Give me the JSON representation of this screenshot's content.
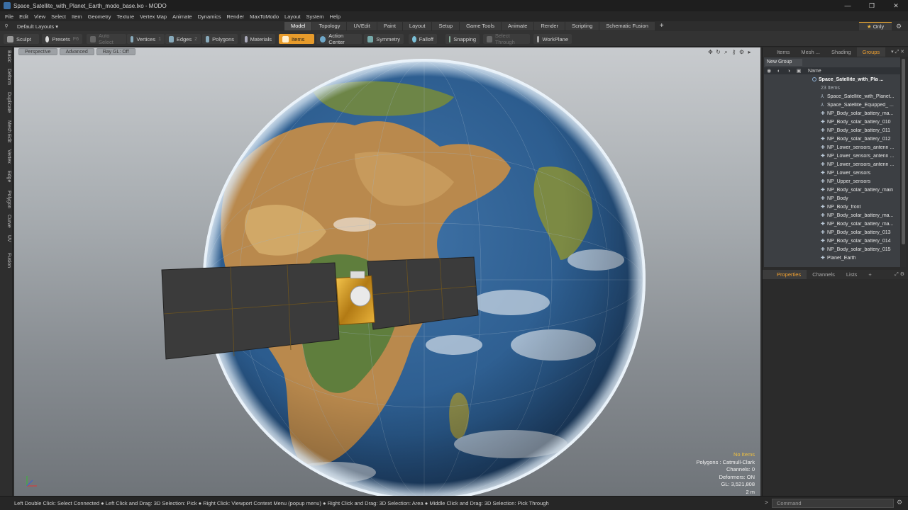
{
  "window": {
    "title": "Space_Satellite_with_Planet_Earth_modo_base.lxo - MODO",
    "controls": [
      "—",
      "❐",
      "✕"
    ]
  },
  "menu": [
    "File",
    "Edit",
    "View",
    "Select",
    "Item",
    "Geometry",
    "Texture",
    "Vertex Map",
    "Animate",
    "Dynamics",
    "Render",
    "MaxToModo",
    "Layout",
    "System",
    "Help"
  ],
  "layout": {
    "preset": "Default Layouts ▾",
    "tabs": [
      "Model",
      "Topology",
      "UVEdit",
      "Paint",
      "Layout",
      "Setup",
      "Game Tools",
      "Animate",
      "Render",
      "Scripting",
      "Schematic Fusion"
    ],
    "active_tab": "Model",
    "plus": "+",
    "only_label": "Only"
  },
  "toolbar": {
    "sculpt": "Sculpt",
    "presets": "Presets",
    "presets_key": "F6",
    "auto_select": "Auto Select",
    "vertices": "Vertices",
    "vertices_key": "1",
    "edges": "Edges",
    "edges_key": "2",
    "polygons": "Polygons",
    "materials": "Materials",
    "items": "Items",
    "action_center": "Action Center",
    "symmetry": "Symmetry",
    "falloff": "Falloff",
    "snapping": "Snapping",
    "select_through": "Select Through",
    "workplane": "WorkPlane"
  },
  "left_tabs": [
    "Basic",
    "Deform",
    "Duplicate",
    "Mesh Edit",
    "Vertex",
    "Edge",
    "Polygon",
    "Curve",
    "UV",
    "Fusion"
  ],
  "viewport": {
    "view_mode": "Perspective",
    "shading": "Advanced",
    "raygl": "Ray GL: Off",
    "info": {
      "no_items": "No Items",
      "polygons": "Polygons : Catmull-Clark",
      "channels": "Channels: 0",
      "deformers": "Deformers: ON",
      "gl": "GL: 3,521,808",
      "scale": "2 m"
    }
  },
  "panel_tabs": [
    "Items",
    "Mesh ...",
    "Shading",
    "Groups"
  ],
  "panel_active": "Groups",
  "groups": {
    "new_group": "New Group",
    "name_header": "Name",
    "root": "Space_Satellite_with_Pla ...",
    "count": "23 Items",
    "items": [
      "Space_Satellite_with_Planet...",
      "Space_Satellite_Equipped_ ...",
      "NP_Body_solar_battery_ma...",
      "NP_Body_solar_battery_010",
      "NP_Body_solar_battery_011",
      "NP_Body_solar_battery_012",
      "NP_Lower_sensors_antenn ...",
      "NP_Lower_sensors_antenn ...",
      "NP_Lower_sensors_antenn ...",
      "NP_Lower_sensors",
      "NP_Upper_sensors",
      "NP_Body_solar_battery_main",
      "NP_Body",
      "NP_Body_front",
      "NP_Body_solar_battery_ma...",
      "NP_Body_solar_battery_ma...",
      "NP_Body_solar_battery_013",
      "NP_Body_solar_battery_014",
      "NP_Body_solar_battery_015",
      "Planet_Earth"
    ]
  },
  "lower_tabs": [
    "Properties",
    "Channels",
    "Lists"
  ],
  "lower_active": "Properties",
  "status": {
    "hint": "Left Double Click: Select Connected ● Left Click and Drag: 3D Selection: Pick ● Right Click: Viewport Context Menu (popup menu) ● Right Click and Drag: 3D Selection: Area ● Middle Click and Drag: 3D Selection: Pick Through",
    "command_placeholder": "Command"
  },
  "colors": {
    "accent": "#e79b2b",
    "ocean": "#2a5a8c",
    "land": "#b8864a",
    "panel": "#1a1a1a"
  }
}
